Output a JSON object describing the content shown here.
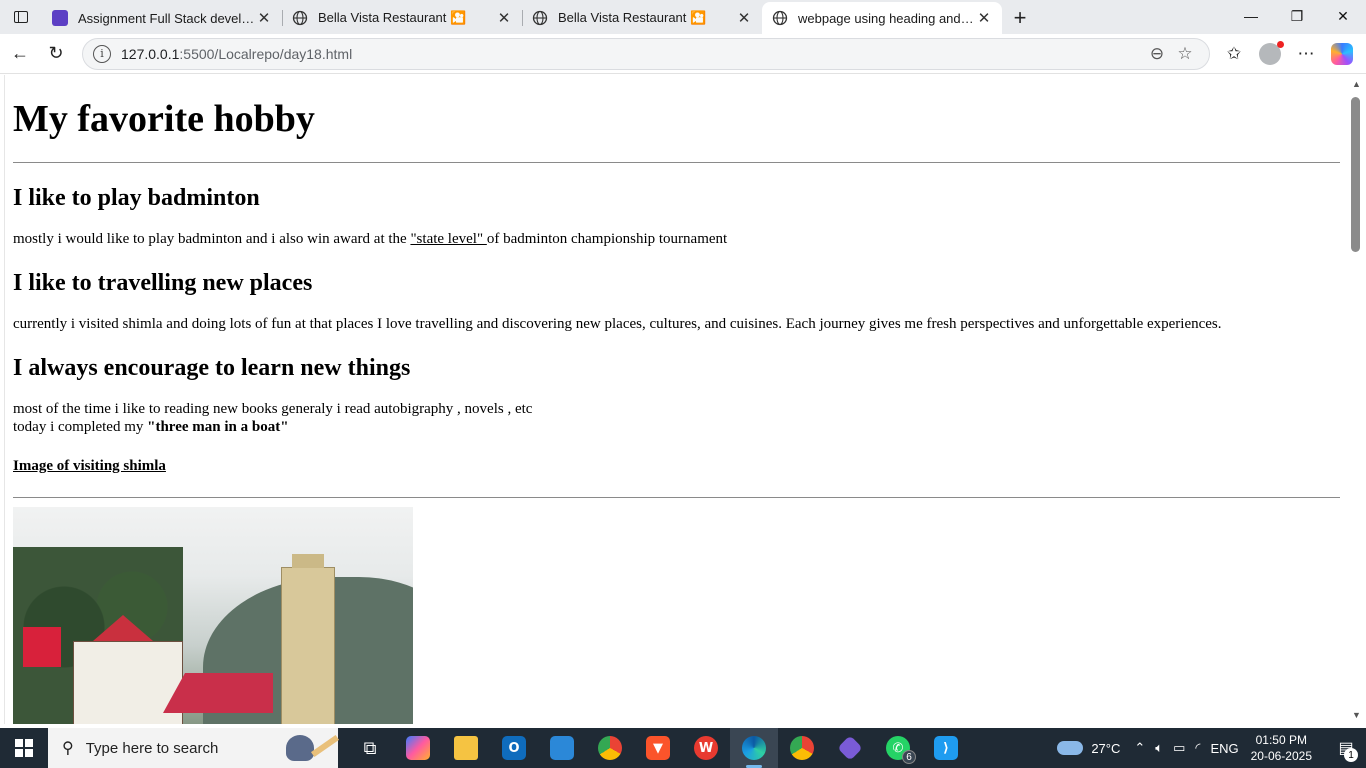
{
  "browser": {
    "tabs": [
      {
        "title": "Assignment Full Stack developme",
        "favicon": "purple-doc-icon",
        "active": false
      },
      {
        "title": "Bella Vista Restaurant 🎦",
        "favicon": "globe-icon",
        "active": false
      },
      {
        "title": "Bella Vista Restaurant 🎦",
        "favicon": "globe-icon",
        "active": false
      },
      {
        "title": "webpage using heading and para",
        "favicon": "globe-icon",
        "active": true
      }
    ],
    "new_tab": "+",
    "address": {
      "host": "127.0.0.1",
      "path": ":5500/Localrepo/day18.html"
    }
  },
  "page": {
    "h1": "My favorite hobby",
    "section1": {
      "heading": "I like to play badminton",
      "text_before": "mostly i would like to play badminton and i also win award at the ",
      "link": "\"state level\" ",
      "text_after": "of badminton championship tournament"
    },
    "section2": {
      "heading": "I like to travelling new places",
      "text": "currently i visited shimla and doing lots of fun at that places I love travelling and discovering new places, cultures, and cuisines. Each journey gives me fresh perspectives and unforgettable experiences."
    },
    "section3": {
      "heading": "I always encourage to learn new things",
      "line1": "most of the time i like to reading new books generaly i read autobigraphy , novels , etc",
      "line2_before": "today i completed my ",
      "line2_bold": "\"three man in a boat\""
    },
    "image_caption": "Image of visiting shimla"
  },
  "taskbar": {
    "search_placeholder": "Type here to search",
    "whatsapp_badge": "6",
    "weather": "27°C",
    "language": "ENG",
    "time": "01:50 PM",
    "date": "20-06-2025",
    "notification_badge": "1"
  },
  "colors": {
    "tabbar_bg": "#e9ebee",
    "taskbar_bg": "#1f2a35",
    "active_indicator": "#76b9ed"
  }
}
